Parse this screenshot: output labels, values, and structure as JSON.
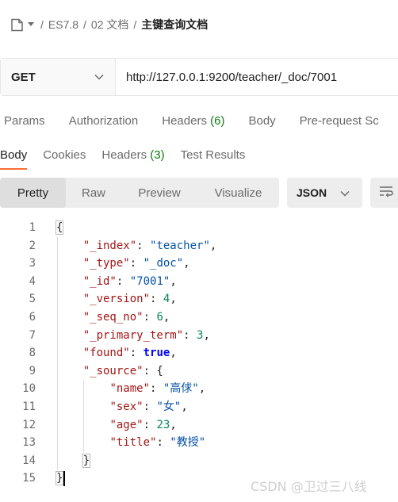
{
  "breadcrumb": {
    "items": [
      "ES7.8",
      "02 文档",
      "主键查询文档"
    ],
    "separator": "/"
  },
  "request": {
    "method": "GET",
    "url": "http://127.0.0.1:9200/teacher/_doc/7001"
  },
  "request_tabs": [
    {
      "label": "Params",
      "count": ""
    },
    {
      "label": "Authorization",
      "count": ""
    },
    {
      "label": "Headers",
      "count": "(6)"
    },
    {
      "label": "Body",
      "count": ""
    },
    {
      "label": "Pre-request Sc",
      "count": ""
    }
  ],
  "response_tabs": [
    {
      "label": "Body",
      "count": ""
    },
    {
      "label": "Cookies",
      "count": ""
    },
    {
      "label": "Headers",
      "count": "(3)"
    },
    {
      "label": "Test Results",
      "count": ""
    }
  ],
  "response_tabs_active": "Body",
  "view_modes": [
    "Pretty",
    "Raw",
    "Preview",
    "Visualize"
  ],
  "view_mode_active": "Pretty",
  "format": "JSON",
  "code_lines": [
    {
      "n": "1",
      "indent": 0,
      "tokens": [
        {
          "t": "{",
          "c": "p"
        }
      ]
    },
    {
      "n": "2",
      "indent": 1,
      "tokens": [
        {
          "t": "\"_index\"",
          "c": "key"
        },
        {
          "t": ": ",
          "c": "p"
        },
        {
          "t": "\"teacher\"",
          "c": "str"
        },
        {
          "t": ",",
          "c": "p"
        }
      ]
    },
    {
      "n": "3",
      "indent": 1,
      "tokens": [
        {
          "t": "\"_type\"",
          "c": "key"
        },
        {
          "t": ": ",
          "c": "p"
        },
        {
          "t": "\"_doc\"",
          "c": "str"
        },
        {
          "t": ",",
          "c": "p"
        }
      ]
    },
    {
      "n": "4",
      "indent": 1,
      "tokens": [
        {
          "t": "\"_id\"",
          "c": "key"
        },
        {
          "t": ": ",
          "c": "p"
        },
        {
          "t": "\"7001\"",
          "c": "str"
        },
        {
          "t": ",",
          "c": "p"
        }
      ]
    },
    {
      "n": "5",
      "indent": 1,
      "tokens": [
        {
          "t": "\"_version\"",
          "c": "key"
        },
        {
          "t": ": ",
          "c": "p"
        },
        {
          "t": "4",
          "c": "num"
        },
        {
          "t": ",",
          "c": "p"
        }
      ]
    },
    {
      "n": "6",
      "indent": 1,
      "tokens": [
        {
          "t": "\"_seq_no\"",
          "c": "key"
        },
        {
          "t": ": ",
          "c": "p"
        },
        {
          "t": "6",
          "c": "num"
        },
        {
          "t": ",",
          "c": "p"
        }
      ]
    },
    {
      "n": "7",
      "indent": 1,
      "tokens": [
        {
          "t": "\"_primary_term\"",
          "c": "key"
        },
        {
          "t": ": ",
          "c": "p"
        },
        {
          "t": "3",
          "c": "num"
        },
        {
          "t": ",",
          "c": "p"
        }
      ]
    },
    {
      "n": "8",
      "indent": 1,
      "tokens": [
        {
          "t": "\"found\"",
          "c": "key"
        },
        {
          "t": ": ",
          "c": "p"
        },
        {
          "t": "true",
          "c": "bool"
        },
        {
          "t": ",",
          "c": "p"
        }
      ]
    },
    {
      "n": "9",
      "indent": 1,
      "tokens": [
        {
          "t": "\"_source\"",
          "c": "key"
        },
        {
          "t": ": {",
          "c": "p"
        }
      ]
    },
    {
      "n": "10",
      "indent": 2,
      "tokens": [
        {
          "t": "\"name\"",
          "c": "key"
        },
        {
          "t": ": ",
          "c": "p"
        },
        {
          "t": "\"高俅\"",
          "c": "str"
        },
        {
          "t": ",",
          "c": "p"
        }
      ]
    },
    {
      "n": "11",
      "indent": 2,
      "tokens": [
        {
          "t": "\"sex\"",
          "c": "key"
        },
        {
          "t": ": ",
          "c": "p"
        },
        {
          "t": "\"女\"",
          "c": "str"
        },
        {
          "t": ",",
          "c": "p"
        }
      ]
    },
    {
      "n": "12",
      "indent": 2,
      "tokens": [
        {
          "t": "\"age\"",
          "c": "key"
        },
        {
          "t": ": ",
          "c": "p"
        },
        {
          "t": "23",
          "c": "num"
        },
        {
          "t": ",",
          "c": "p"
        }
      ]
    },
    {
      "n": "13",
      "indent": 2,
      "tokens": [
        {
          "t": "\"title\"",
          "c": "key"
        },
        {
          "t": ": ",
          "c": "p"
        },
        {
          "t": "\"教授\"",
          "c": "str"
        }
      ]
    },
    {
      "n": "14",
      "indent": 1,
      "tokens": [
        {
          "t": "}",
          "c": "p"
        }
      ]
    },
    {
      "n": "15",
      "indent": 0,
      "tokens": [
        {
          "t": "}",
          "c": "p"
        }
      ]
    }
  ],
  "watermark": "CSDN @卫过三八线"
}
